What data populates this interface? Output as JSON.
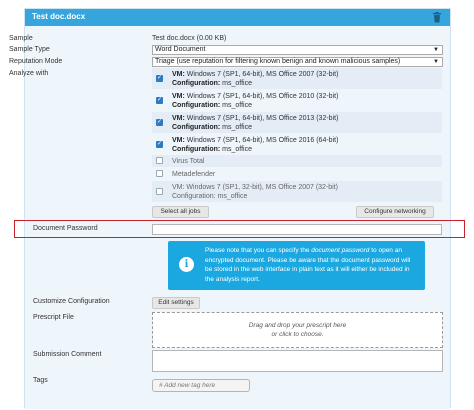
{
  "header": {
    "title": "Test doc.docx"
  },
  "form": {
    "sample_label": "Sample",
    "sample_value": "Test doc.docx (0.00 KB)",
    "sample_type_label": "Sample Type",
    "sample_type_value": "Word Document",
    "reputation_label": "Reputation Mode",
    "reputation_value": "Triage (use reputation for filtering known benign and known malicious samples)",
    "analyze_label": "Analyze with",
    "vms": [
      {
        "title": "VM:",
        "desc": "Windows 7 (SP1, 64-bit), MS Office 2007 (32-bit)",
        "config_label": "Configuration:",
        "config": "ms_office",
        "checked": true
      },
      {
        "title": "VM:",
        "desc": "Windows 7 (SP1, 64-bit), MS Office 2010 (32-bit)",
        "config_label": "Configuration:",
        "config": "ms_office",
        "checked": true
      },
      {
        "title": "VM:",
        "desc": "Windows 7 (SP1, 64-bit), MS Office 2013 (32-bit)",
        "config_label": "Configuration:",
        "config": "ms_office",
        "checked": true
      },
      {
        "title": "VM:",
        "desc": "Windows 7 (SP1, 64-bit), MS Office 2016 (64-bit)",
        "config_label": "Configuration:",
        "config": "ms_office",
        "checked": true
      }
    ],
    "services": [
      "Virus Total",
      "Metadefender"
    ],
    "vm_extra": {
      "desc": "Windows 7 (SP1, 32-bit), MS Office 2007 (32-bit)",
      "config_label": "Configuration:",
      "config": "ms_office"
    },
    "select_all_label": "Select all jobs",
    "configure_networking_label": "Configure networking",
    "password_label": "Document Password",
    "info_line1": "Please note that you can specify the",
    "info_em": "document password",
    "info_line1b": "to open",
    "info_rest": "an encrypted document. Please be aware that the document password will be stored in the web interface in plain text as it will either be included in the analysis report.",
    "custom_config_label": "Customize Configuration",
    "edit_settings_label": "Edit settings",
    "prescript_label": "Prescript File",
    "drop_line1": "Drag and drop your prescript here",
    "drop_line2": "or click to choose.",
    "submission_comment_label": "Submission Comment",
    "tags_label": "Tags",
    "tag_placeholder": "# Add new tag here"
  },
  "colors": {
    "header": "#37a5dd",
    "info": "#1ba8e0",
    "highlight": "#c8232c"
  }
}
